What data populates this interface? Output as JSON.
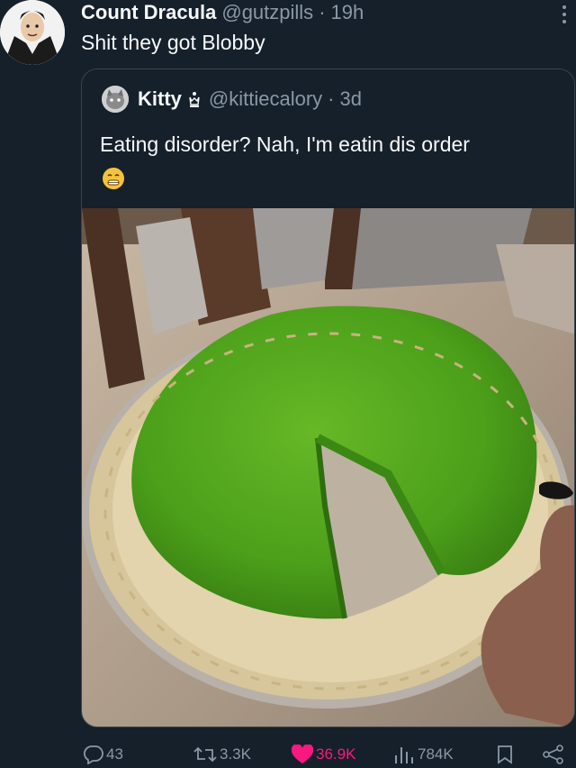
{
  "tweet": {
    "author_name": "Count Dracula",
    "handle": "@gutzpills",
    "separator": "·",
    "time": "19h",
    "text": "Shit they got Blobby"
  },
  "quote": {
    "author_name": "Kitty",
    "handle": "@kittiecalory",
    "separator": "·",
    "time": "3d",
    "text": "Eating disorder? Nah, I'm eatin dis order",
    "emoji": "grimacing-face-emoji"
  },
  "actions": {
    "replies": "43",
    "reposts": "3.3K",
    "likes": "36.9K",
    "views": "784K"
  },
  "colors": {
    "background": "#15202b",
    "secondary_text": "#8b98a5",
    "like": "#f91880",
    "jello": "#4ca01a"
  }
}
